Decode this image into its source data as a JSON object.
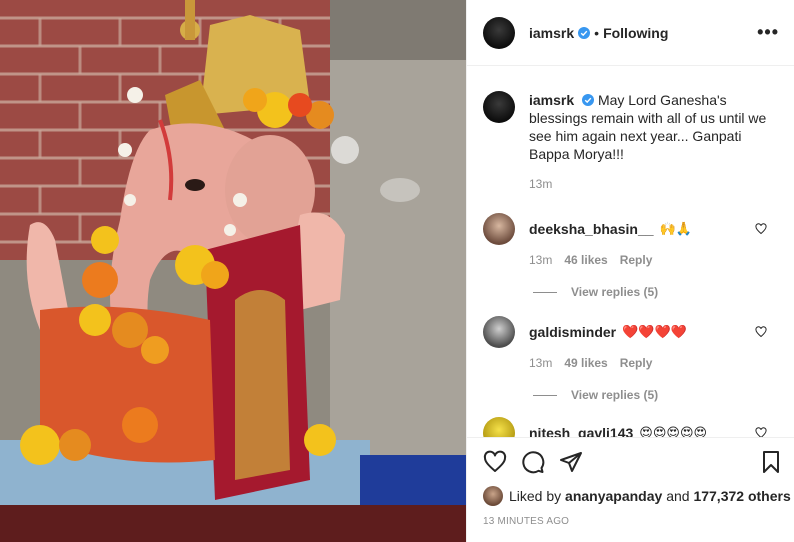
{
  "post": {
    "username": "iamsrk",
    "follow_status": "Following",
    "separator": "•",
    "more_label": "•••",
    "caption": "May Lord Ganesha's blessings remain with all of us until we see him again next year... Ganpati Bappa Morya!!!",
    "caption_time": "13m",
    "liked_by_prefix": "Liked by",
    "liked_by_user": "ananyapanday",
    "liked_by_connector": "and",
    "liked_by_count": "177,372 others",
    "posted_time": "13 MINUTES AGO"
  },
  "comments": [
    {
      "username": "deeksha_bhasin__",
      "text": "🙌🙏",
      "time": "13m",
      "likes": "46 likes",
      "reply_label": "Reply",
      "view_replies": "View replies (5)"
    },
    {
      "username": "galdisminder",
      "text": "❤️❤️❤️❤️",
      "time": "13m",
      "likes": "49 likes",
      "reply_label": "Reply",
      "view_replies": "View replies (5)"
    },
    {
      "username": "nitesh_gavli143",
      "text": "😍😍😍😍😍"
    }
  ],
  "icons": {
    "like": "heart-icon",
    "comment": "comment-icon",
    "share": "paper-plane-icon",
    "save": "bookmark-icon",
    "verified": "verified-badge-icon",
    "more": "more-options-icon"
  },
  "colors": {
    "verified_blue": "#3897f0",
    "muted_text": "#8e8e8e",
    "text": "#262626",
    "divider": "#efefef"
  }
}
